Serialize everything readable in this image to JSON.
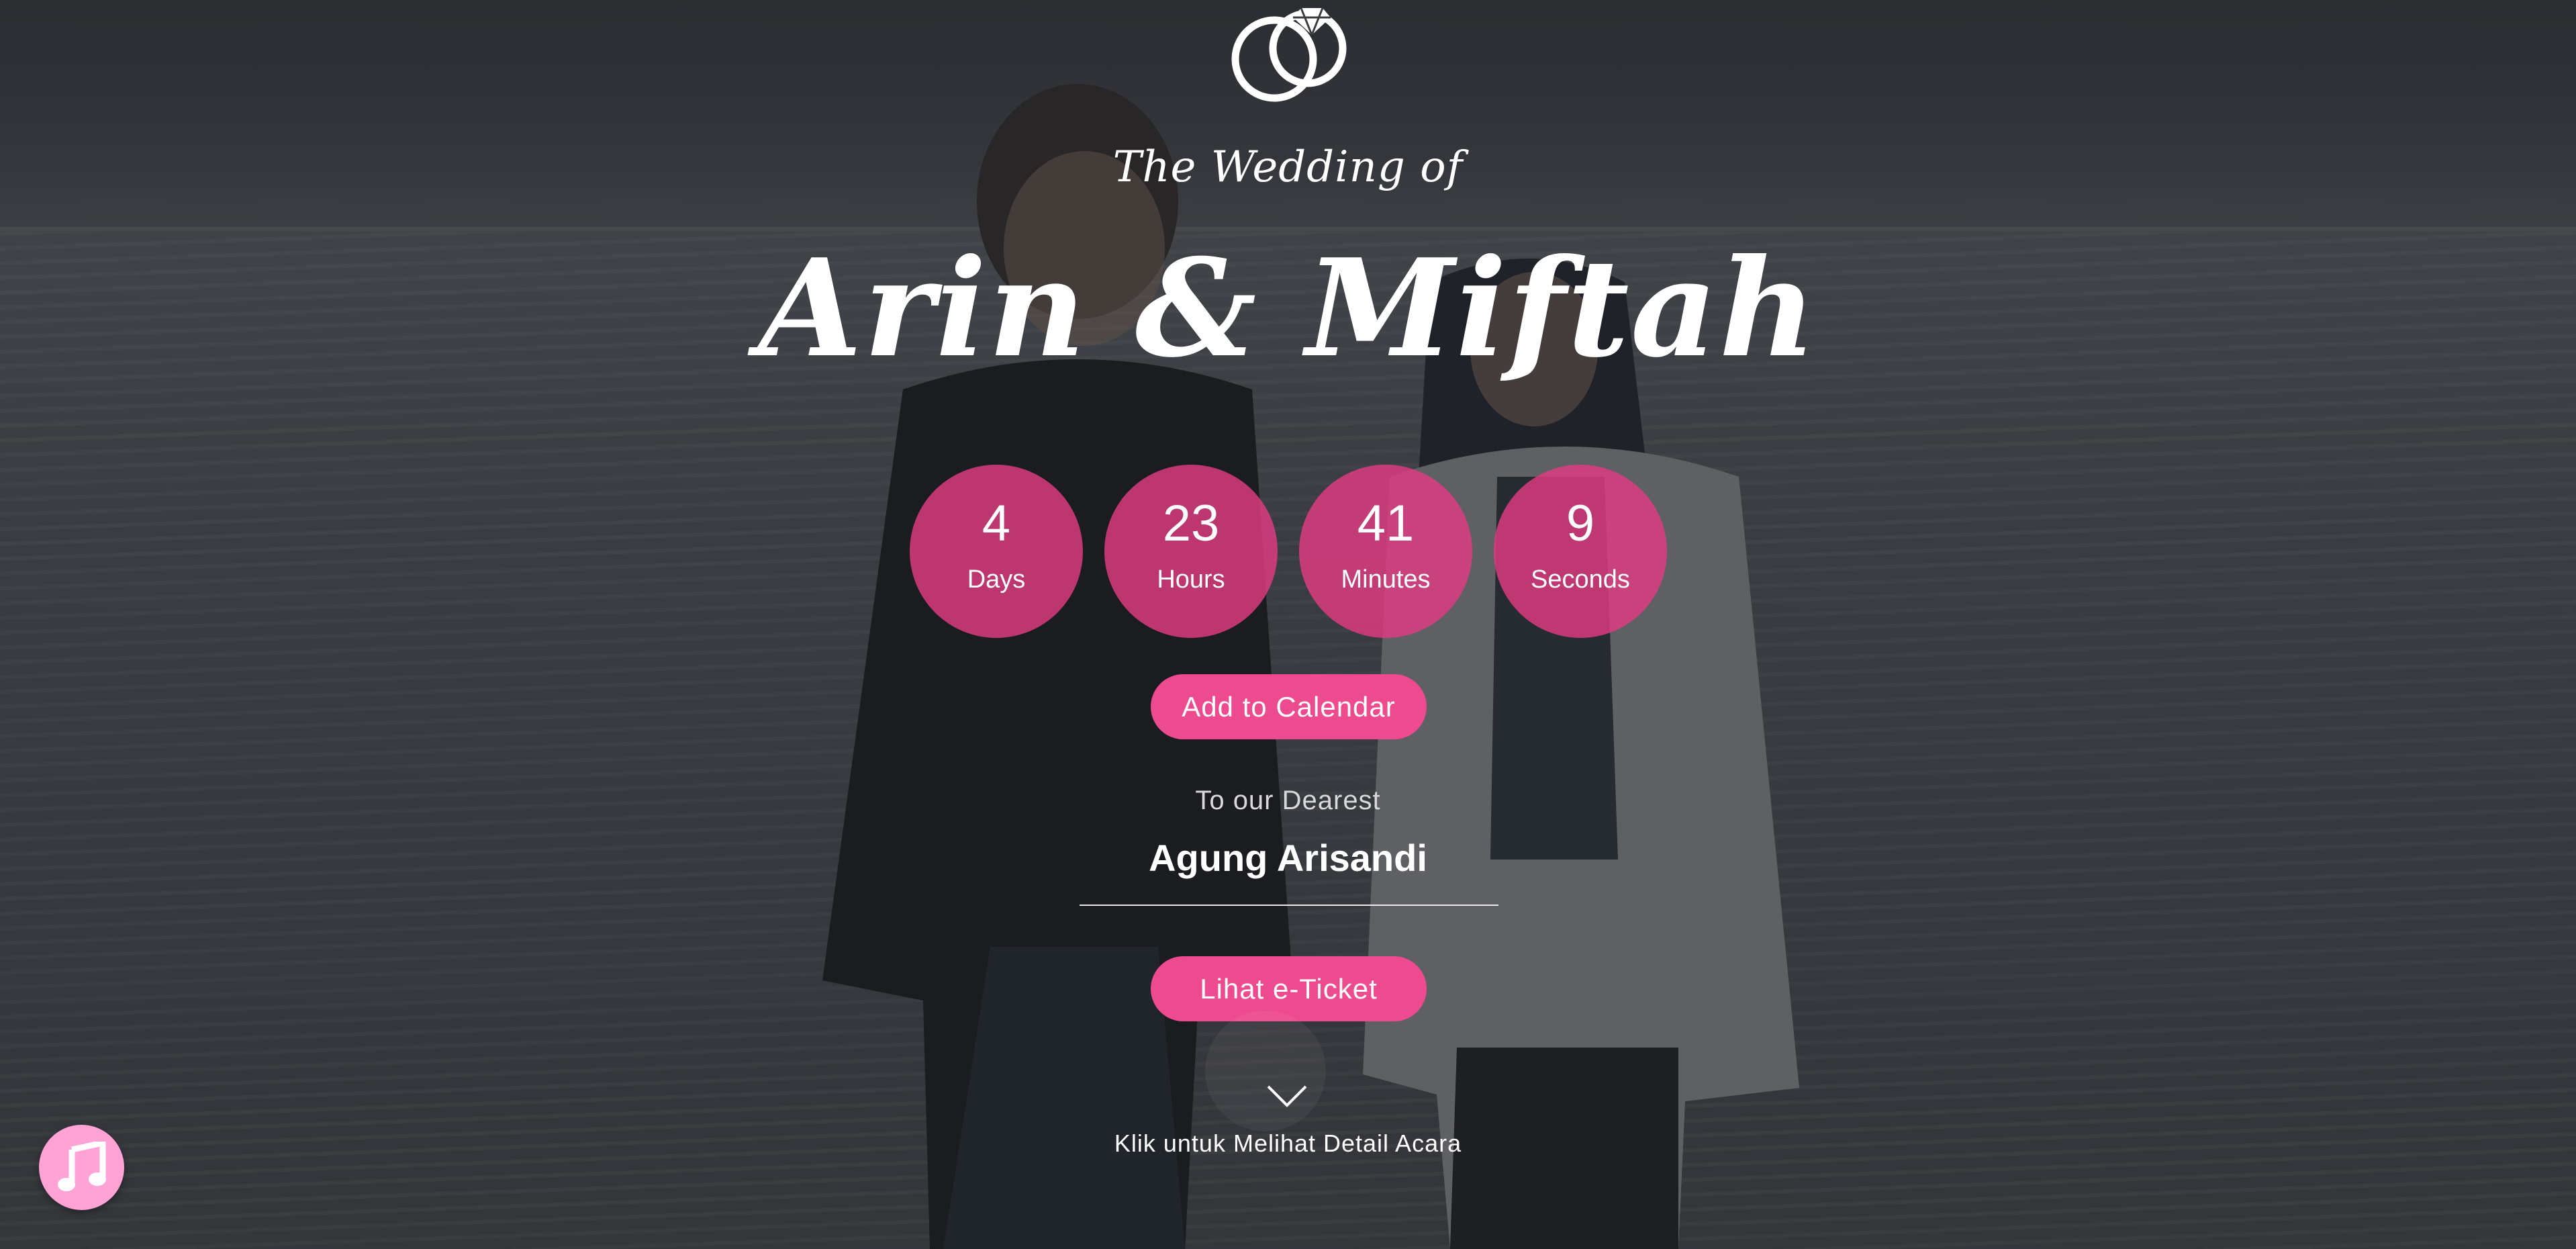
{
  "hero": {
    "kicker": "The Wedding of",
    "names": "Arin & Miftah"
  },
  "countdown": [
    {
      "value": "4",
      "label": "Days"
    },
    {
      "value": "23",
      "label": "Hours"
    },
    {
      "value": "41",
      "label": "Minutes"
    },
    {
      "value": "9",
      "label": "Seconds"
    }
  ],
  "actions": {
    "add_calendar": "Add to Calendar",
    "eticket": "Lihat e-Ticket"
  },
  "invite": {
    "greeting": "To our Dearest",
    "guest_name": "Agung Arisandi"
  },
  "scroll": {
    "hint": "Klik untuk Melihat Detail Acara"
  },
  "icons": {
    "logo": "wedding-rings-icon",
    "scroll": "chevron-down-icon",
    "music": "music-note-icon"
  },
  "colors": {
    "accent": "#ee4a8f",
    "circle": "#e23c82",
    "music_button": "#ffa2d6"
  }
}
